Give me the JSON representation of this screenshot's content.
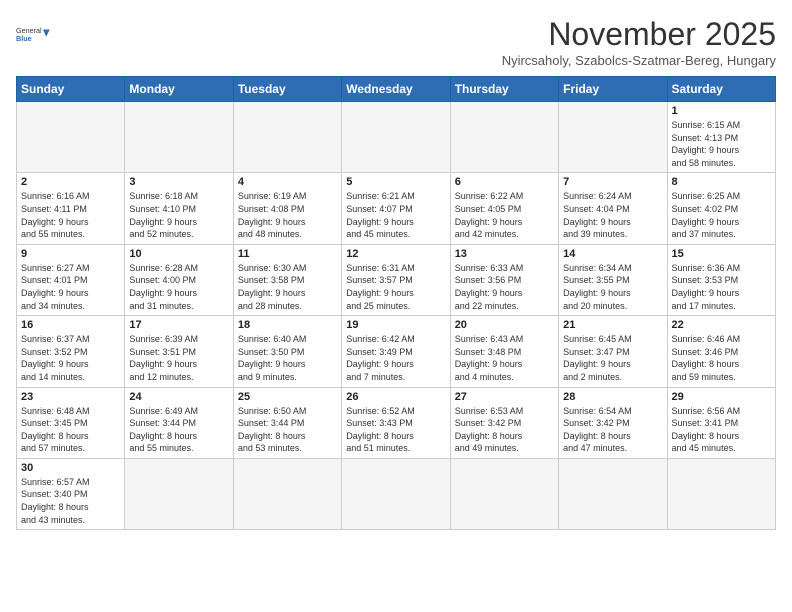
{
  "logo": {
    "text_general": "General",
    "text_blue": "Blue"
  },
  "header": {
    "title": "November 2025",
    "subtitle": "Nyircsaholy, Szabolcs-Szatmar-Bereg, Hungary"
  },
  "weekdays": [
    "Sunday",
    "Monday",
    "Tuesday",
    "Wednesday",
    "Thursday",
    "Friday",
    "Saturday"
  ],
  "weeks": [
    [
      {
        "day": "",
        "info": ""
      },
      {
        "day": "",
        "info": ""
      },
      {
        "day": "",
        "info": ""
      },
      {
        "day": "",
        "info": ""
      },
      {
        "day": "",
        "info": ""
      },
      {
        "day": "",
        "info": ""
      },
      {
        "day": "1",
        "info": "Sunrise: 6:15 AM\nSunset: 4:13 PM\nDaylight: 9 hours\nand 58 minutes."
      }
    ],
    [
      {
        "day": "2",
        "info": "Sunrise: 6:16 AM\nSunset: 4:11 PM\nDaylight: 9 hours\nand 55 minutes."
      },
      {
        "day": "3",
        "info": "Sunrise: 6:18 AM\nSunset: 4:10 PM\nDaylight: 9 hours\nand 52 minutes."
      },
      {
        "day": "4",
        "info": "Sunrise: 6:19 AM\nSunset: 4:08 PM\nDaylight: 9 hours\nand 48 minutes."
      },
      {
        "day": "5",
        "info": "Sunrise: 6:21 AM\nSunset: 4:07 PM\nDaylight: 9 hours\nand 45 minutes."
      },
      {
        "day": "6",
        "info": "Sunrise: 6:22 AM\nSunset: 4:05 PM\nDaylight: 9 hours\nand 42 minutes."
      },
      {
        "day": "7",
        "info": "Sunrise: 6:24 AM\nSunset: 4:04 PM\nDaylight: 9 hours\nand 39 minutes."
      },
      {
        "day": "8",
        "info": "Sunrise: 6:25 AM\nSunset: 4:02 PM\nDaylight: 9 hours\nand 37 minutes."
      }
    ],
    [
      {
        "day": "9",
        "info": "Sunrise: 6:27 AM\nSunset: 4:01 PM\nDaylight: 9 hours\nand 34 minutes."
      },
      {
        "day": "10",
        "info": "Sunrise: 6:28 AM\nSunset: 4:00 PM\nDaylight: 9 hours\nand 31 minutes."
      },
      {
        "day": "11",
        "info": "Sunrise: 6:30 AM\nSunset: 3:58 PM\nDaylight: 9 hours\nand 28 minutes."
      },
      {
        "day": "12",
        "info": "Sunrise: 6:31 AM\nSunset: 3:57 PM\nDaylight: 9 hours\nand 25 minutes."
      },
      {
        "day": "13",
        "info": "Sunrise: 6:33 AM\nSunset: 3:56 PM\nDaylight: 9 hours\nand 22 minutes."
      },
      {
        "day": "14",
        "info": "Sunrise: 6:34 AM\nSunset: 3:55 PM\nDaylight: 9 hours\nand 20 minutes."
      },
      {
        "day": "15",
        "info": "Sunrise: 6:36 AM\nSunset: 3:53 PM\nDaylight: 9 hours\nand 17 minutes."
      }
    ],
    [
      {
        "day": "16",
        "info": "Sunrise: 6:37 AM\nSunset: 3:52 PM\nDaylight: 9 hours\nand 14 minutes."
      },
      {
        "day": "17",
        "info": "Sunrise: 6:39 AM\nSunset: 3:51 PM\nDaylight: 9 hours\nand 12 minutes."
      },
      {
        "day": "18",
        "info": "Sunrise: 6:40 AM\nSunset: 3:50 PM\nDaylight: 9 hours\nand 9 minutes."
      },
      {
        "day": "19",
        "info": "Sunrise: 6:42 AM\nSunset: 3:49 PM\nDaylight: 9 hours\nand 7 minutes."
      },
      {
        "day": "20",
        "info": "Sunrise: 6:43 AM\nSunset: 3:48 PM\nDaylight: 9 hours\nand 4 minutes."
      },
      {
        "day": "21",
        "info": "Sunrise: 6:45 AM\nSunset: 3:47 PM\nDaylight: 9 hours\nand 2 minutes."
      },
      {
        "day": "22",
        "info": "Sunrise: 6:46 AM\nSunset: 3:46 PM\nDaylight: 8 hours\nand 59 minutes."
      }
    ],
    [
      {
        "day": "23",
        "info": "Sunrise: 6:48 AM\nSunset: 3:45 PM\nDaylight: 8 hours\nand 57 minutes."
      },
      {
        "day": "24",
        "info": "Sunrise: 6:49 AM\nSunset: 3:44 PM\nDaylight: 8 hours\nand 55 minutes."
      },
      {
        "day": "25",
        "info": "Sunrise: 6:50 AM\nSunset: 3:44 PM\nDaylight: 8 hours\nand 53 minutes."
      },
      {
        "day": "26",
        "info": "Sunrise: 6:52 AM\nSunset: 3:43 PM\nDaylight: 8 hours\nand 51 minutes."
      },
      {
        "day": "27",
        "info": "Sunrise: 6:53 AM\nSunset: 3:42 PM\nDaylight: 8 hours\nand 49 minutes."
      },
      {
        "day": "28",
        "info": "Sunrise: 6:54 AM\nSunset: 3:42 PM\nDaylight: 8 hours\nand 47 minutes."
      },
      {
        "day": "29",
        "info": "Sunrise: 6:56 AM\nSunset: 3:41 PM\nDaylight: 8 hours\nand 45 minutes."
      }
    ],
    [
      {
        "day": "30",
        "info": "Sunrise: 6:57 AM\nSunset: 3:40 PM\nDaylight: 8 hours\nand 43 minutes."
      },
      {
        "day": "",
        "info": ""
      },
      {
        "day": "",
        "info": ""
      },
      {
        "day": "",
        "info": ""
      },
      {
        "day": "",
        "info": ""
      },
      {
        "day": "",
        "info": ""
      },
      {
        "day": "",
        "info": ""
      }
    ]
  ]
}
